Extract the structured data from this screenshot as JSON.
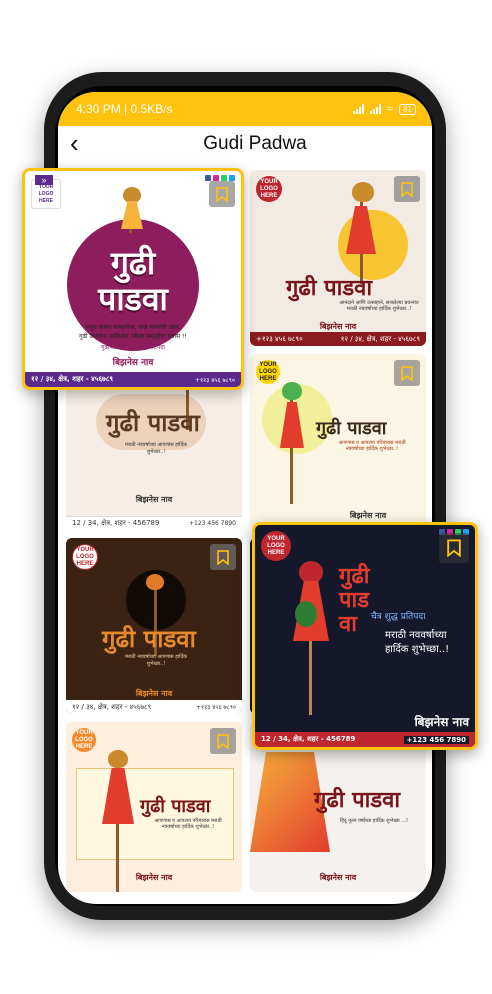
{
  "status_bar": {
    "time": "4:30 PM | 0.5KB/s",
    "battery": "81"
  },
  "app_bar": {
    "back_icon": "chevron-left-icon",
    "title": "Gudi Padwa"
  },
  "colors": {
    "status_bar": "#ffc20e",
    "highlight_border": "#ffc20e",
    "maroon": "#8e1d5e",
    "navy": "#15182a",
    "brown": "#3b2212"
  },
  "templates": [
    {
      "logo": "YOUR LOGO HERE",
      "heading": "गुढी पाडवा",
      "wish": "आनंदाने आणि उत्साहाने, सजलेल्या प्रयत्नांत मराठी नववर्षाच्या हार्दिक शुभेच्छा..!",
      "business": "बिझनेस नाव",
      "address": "१२ / ३४, क्षेत्र, शहर - ४५६७८९",
      "phone": "+१२३ ४५६ ७८९०"
    },
    {
      "heading": "गुढी पाडवा",
      "wish": "मराठी नववर्षाच्या आपणांस हार्दिक शुभेच्छा..!",
      "business": "बिझनेस नाव",
      "address": "12 / 34, क्षेत्र, शहर - 456789",
      "phone": "+123 456 7890"
    },
    {
      "logo": "YOUR LOGO HERE",
      "heading": "गुढी पाडवा",
      "wish": "आपणास व आपल्या परिवारास मराठी नववर्षाच्या हार्दिक शुभेच्छा..!",
      "business": "बिझनेस नाव"
    },
    {
      "logo": "YOUR LOGO HERE",
      "heading": "गुढी पाडवा",
      "wish": "मराठी नववर्षाच्या आपणांस हार्दिक शुभेच्छा..!",
      "business": "बिझनेस नाव",
      "address": "१२ / ३४, क्षेत्र, शहर - ४५६७८९",
      "phone": "+१२३ ४५६ ७८९०"
    },
    {
      "logo": "YOUR LOGO HERE",
      "heading": "गुढी पाडवा",
      "wish": "आपणास व आपल्या परिवारास मराठी नववर्षाच्या हार्दिक शुभेच्छा..!",
      "business": "बिझनेस नाव"
    },
    {
      "heading": "गुढी पाडवा",
      "wish": "हिंदू नूतन वर्षाच्या हार्दिक शुभेच्छा ...!",
      "business": "बिझनेस नाव"
    }
  ],
  "featured_left": {
    "logo": "YOUR LOGO HERE",
    "heading_line1": "गुढी",
    "heading_line2": "पाडवा",
    "wish_line1": "जपून वारसा संस्कृतीचा, राख परंपरेची आस,",
    "wish_line2": "गुढी उभारून आशिर्वाद, सौख्य समृद्धीचा प्रवास !!",
    "tagline": "गुढीपाडवा । चैत्र शुद्ध प्रतिपदा",
    "business": "बिझनेस नाव",
    "address": "१२ / ३४, क्षेत्र, शहर - ४५६७८९",
    "phone": "+१२३ ४५६ ७८९०"
  },
  "featured_right": {
    "logo": "YOUR LOGO HERE",
    "heading": "गुढीपाडवा",
    "tithi": "चैत्र शुद्ध प्रतिपदा",
    "wish_line1": "मराठी नववर्षाच्या",
    "wish_line2": "हार्दिक शुभेच्छा..!",
    "business": "बिझनेस नाव",
    "address": "12 / 34, क्षेत्र, शहर - 456789",
    "phone": "+123 456 7890"
  }
}
